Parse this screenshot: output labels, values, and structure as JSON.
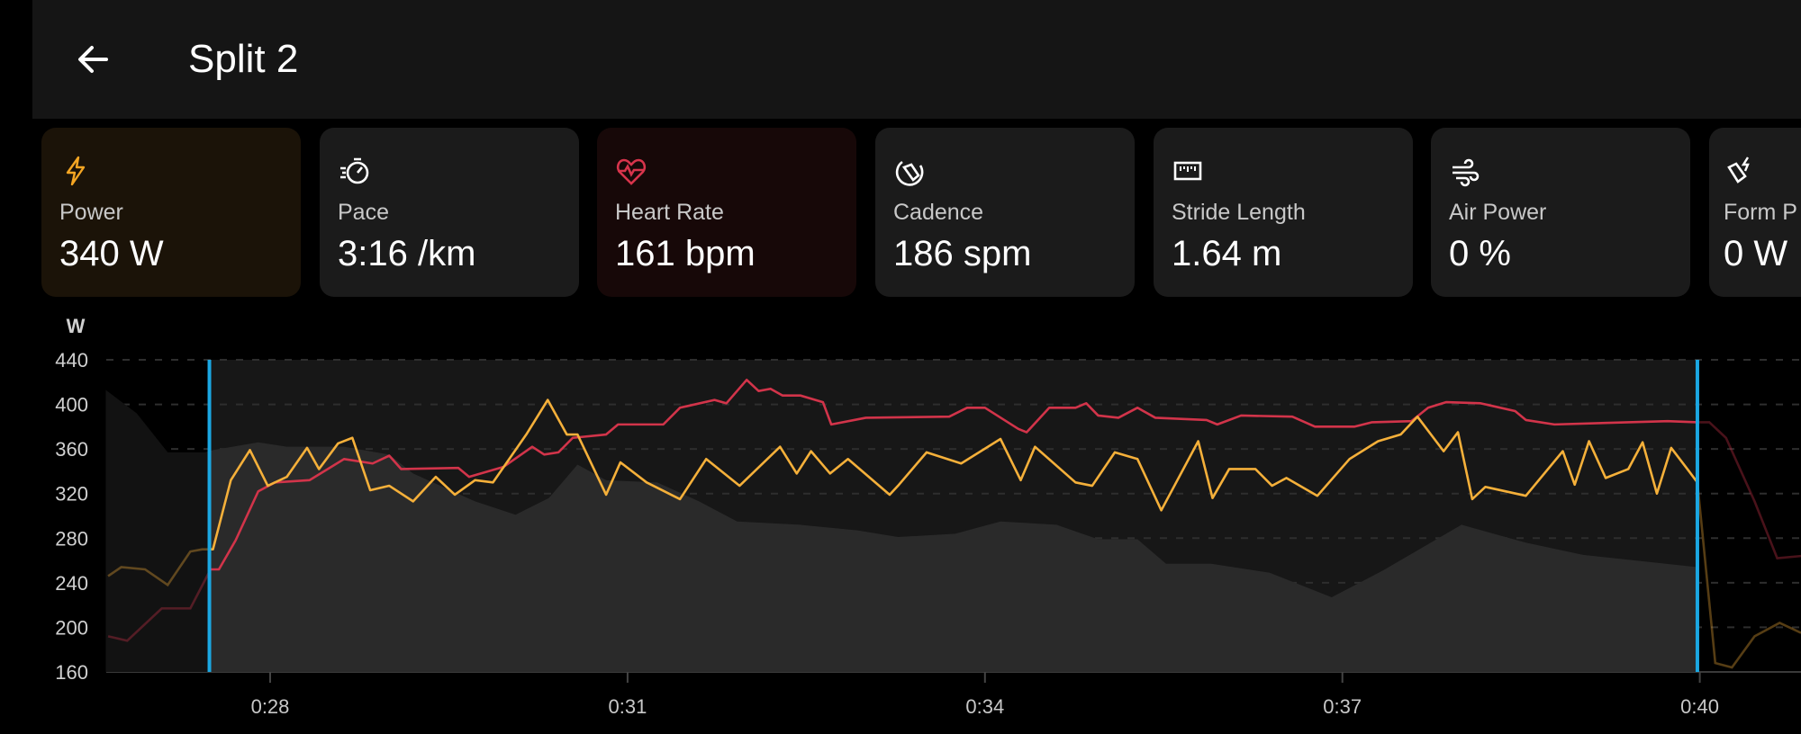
{
  "header": {
    "title": "Split 2",
    "back_icon": "arrow-left-icon"
  },
  "metrics": [
    {
      "label": "Power",
      "value": "340 W",
      "icon": "lightning-icon",
      "color": "#f5a623"
    },
    {
      "label": "Pace",
      "value": "3:16 /km",
      "icon": "stopwatch-icon",
      "color": "#ffffff"
    },
    {
      "label": "Heart Rate",
      "value": "161 bpm",
      "icon": "heart-pulse-icon",
      "color": "#d8344c"
    },
    {
      "label": "Cadence",
      "value": "186 spm",
      "icon": "shoe-cycle-icon",
      "color": "#ffffff"
    },
    {
      "label": "Stride Length",
      "value": "1.64 m",
      "icon": "ruler-icon",
      "color": "#ffffff"
    },
    {
      "label": "Air Power",
      "value": "0 %",
      "icon": "wind-icon",
      "color": "#ffffff"
    },
    {
      "label": "Form P",
      "value": "0 W",
      "icon": "shoe-lightning-icon",
      "color": "#ffffff"
    }
  ],
  "chart_data": {
    "type": "line",
    "ylabel": "W",
    "ylim": [
      160,
      440
    ],
    "yticks": [
      440,
      400,
      360,
      320,
      280,
      240,
      200,
      160
    ],
    "xlim": [
      26.62,
      40.85
    ],
    "xticks": [
      {
        "value": 28,
        "label": "0:28"
      },
      {
        "value": 31,
        "label": "0:31"
      },
      {
        "value": 34,
        "label": "0:34"
      },
      {
        "value": 37,
        "label": "0:37"
      },
      {
        "value": 40,
        "label": "0:40"
      }
    ],
    "grid": true,
    "selection": [
      27.49,
      39.98
    ],
    "colors": {
      "power": "#f5b03a",
      "heart_rate": "#d2344a",
      "area": "#2a2a2a",
      "selection": "#1ba7e2"
    },
    "series": [
      {
        "key": "power",
        "points": [
          [
            26.64,
            246
          ],
          [
            26.75,
            254
          ],
          [
            26.95,
            252
          ],
          [
            27.14,
            238
          ],
          [
            27.33,
            268
          ],
          [
            27.43,
            270
          ],
          [
            27.52,
            270
          ],
          [
            27.67,
            332
          ],
          [
            27.83,
            359
          ],
          [
            27.98,
            327
          ],
          [
            28.14,
            335
          ],
          [
            28.31,
            361
          ],
          [
            28.41,
            342
          ],
          [
            28.57,
            365
          ],
          [
            28.69,
            370
          ],
          [
            28.84,
            323
          ],
          [
            29.0,
            327
          ],
          [
            29.2,
            313
          ],
          [
            29.39,
            335
          ],
          [
            29.55,
            319
          ],
          [
            29.72,
            332
          ],
          [
            29.87,
            330
          ],
          [
            30.15,
            373
          ],
          [
            30.33,
            404
          ],
          [
            30.49,
            373
          ],
          [
            30.58,
            373
          ],
          [
            30.82,
            319
          ],
          [
            30.94,
            348
          ],
          [
            31.16,
            330
          ],
          [
            31.44,
            315
          ],
          [
            31.66,
            351
          ],
          [
            31.94,
            327
          ],
          [
            32.28,
            362
          ],
          [
            32.42,
            338
          ],
          [
            32.54,
            358
          ],
          [
            32.7,
            338
          ],
          [
            32.85,
            351
          ],
          [
            33.2,
            319
          ],
          [
            33.27,
            327
          ],
          [
            33.51,
            357
          ],
          [
            33.8,
            347
          ],
          [
            34.13,
            369
          ],
          [
            34.3,
            332
          ],
          [
            34.42,
            362
          ],
          [
            34.76,
            330
          ],
          [
            34.9,
            327
          ],
          [
            35.09,
            357
          ],
          [
            35.28,
            351
          ],
          [
            35.48,
            305
          ],
          [
            35.79,
            367
          ],
          [
            35.91,
            316
          ],
          [
            36.05,
            342
          ],
          [
            36.27,
            342
          ],
          [
            36.41,
            327
          ],
          [
            36.53,
            334
          ],
          [
            36.79,
            318
          ],
          [
            37.06,
            351
          ],
          [
            37.3,
            367
          ],
          [
            37.49,
            373
          ],
          [
            37.63,
            389
          ],
          [
            37.85,
            358
          ],
          [
            37.97,
            375
          ],
          [
            38.09,
            315
          ],
          [
            38.2,
            326
          ],
          [
            38.54,
            318
          ],
          [
            38.85,
            358
          ],
          [
            38.95,
            328
          ],
          [
            39.07,
            367
          ],
          [
            39.21,
            334
          ],
          [
            39.4,
            342
          ],
          [
            39.52,
            366
          ],
          [
            39.64,
            320
          ],
          [
            39.76,
            361
          ],
          [
            39.91,
            340
          ],
          [
            39.98,
            330
          ],
          [
            40.13,
            168
          ],
          [
            40.27,
            164
          ],
          [
            40.46,
            192
          ],
          [
            40.67,
            204
          ],
          [
            40.85,
            195
          ]
        ]
      },
      {
        "key": "heart_rate",
        "points": [
          [
            26.64,
            192
          ],
          [
            26.8,
            188
          ],
          [
            27.09,
            217
          ],
          [
            27.33,
            217
          ],
          [
            27.5,
            252
          ],
          [
            27.57,
            252
          ],
          [
            27.71,
            278
          ],
          [
            27.9,
            322
          ],
          [
            28.04,
            330
          ],
          [
            28.33,
            332
          ],
          [
            28.62,
            351
          ],
          [
            28.86,
            347
          ],
          [
            29.0,
            354
          ],
          [
            29.1,
            342
          ],
          [
            29.58,
            343
          ],
          [
            29.67,
            335
          ],
          [
            29.96,
            344
          ],
          [
            30.2,
            362
          ],
          [
            30.3,
            355
          ],
          [
            30.42,
            357
          ],
          [
            30.54,
            370
          ],
          [
            30.82,
            373
          ],
          [
            30.92,
            382
          ],
          [
            31.3,
            382
          ],
          [
            31.44,
            397
          ],
          [
            31.73,
            404
          ],
          [
            31.83,
            401
          ],
          [
            32.0,
            422
          ],
          [
            32.1,
            412
          ],
          [
            32.2,
            414
          ],
          [
            32.3,
            408
          ],
          [
            32.45,
            408
          ],
          [
            32.64,
            402
          ],
          [
            32.71,
            382
          ],
          [
            33.0,
            388
          ],
          [
            33.7,
            389
          ],
          [
            33.85,
            397
          ],
          [
            34.0,
            397
          ],
          [
            34.28,
            378
          ],
          [
            34.35,
            375
          ],
          [
            34.54,
            397
          ],
          [
            34.76,
            397
          ],
          [
            34.85,
            401
          ],
          [
            34.95,
            390
          ],
          [
            35.12,
            388
          ],
          [
            35.28,
            397
          ],
          [
            35.43,
            388
          ],
          [
            35.86,
            386
          ],
          [
            35.95,
            382
          ],
          [
            36.15,
            390
          ],
          [
            36.58,
            389
          ],
          [
            36.77,
            380
          ],
          [
            37.1,
            380
          ],
          [
            37.25,
            384
          ],
          [
            37.58,
            385
          ],
          [
            37.72,
            397
          ],
          [
            37.87,
            402
          ],
          [
            38.16,
            401
          ],
          [
            38.45,
            394
          ],
          [
            38.54,
            386
          ],
          [
            38.78,
            382
          ],
          [
            39.73,
            385
          ],
          [
            39.98,
            384
          ],
          [
            40.08,
            384
          ],
          [
            40.22,
            370
          ],
          [
            40.46,
            313
          ],
          [
            40.65,
            262
          ],
          [
            40.85,
            264
          ]
        ]
      },
      {
        "key": "area",
        "points": [
          [
            26.62,
            413
          ],
          [
            26.88,
            392
          ],
          [
            27.14,
            357
          ],
          [
            27.45,
            357
          ],
          [
            27.52,
            359
          ],
          [
            27.9,
            366
          ],
          [
            28.14,
            362
          ],
          [
            28.62,
            362
          ],
          [
            29.0,
            355
          ],
          [
            29.2,
            338
          ],
          [
            29.72,
            313
          ],
          [
            30.06,
            301
          ],
          [
            30.34,
            316
          ],
          [
            30.58,
            346
          ],
          [
            30.82,
            332
          ],
          [
            31.25,
            330
          ],
          [
            31.6,
            313
          ],
          [
            31.92,
            295
          ],
          [
            32.45,
            292
          ],
          [
            32.93,
            287
          ],
          [
            33.27,
            281
          ],
          [
            33.75,
            284
          ],
          [
            34.13,
            295
          ],
          [
            34.6,
            292
          ],
          [
            34.95,
            279
          ],
          [
            35.28,
            279
          ],
          [
            35.52,
            257
          ],
          [
            35.9,
            257
          ],
          [
            36.39,
            249
          ],
          [
            36.91,
            227
          ],
          [
            37.34,
            251
          ],
          [
            38.0,
            292
          ],
          [
            38.54,
            276
          ],
          [
            39.02,
            265
          ],
          [
            39.98,
            254
          ]
        ]
      }
    ]
  }
}
